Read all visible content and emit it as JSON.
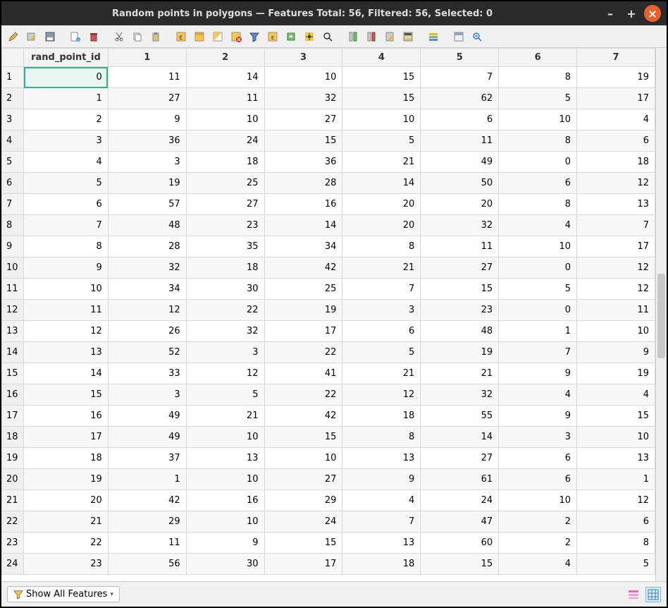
{
  "titlebar": {
    "title": "Random points in polygons — Features Total: 56, Filtered: 56, Selected: 0",
    "minimize": "–",
    "maximize": "+",
    "close": "×"
  },
  "toolbar_icons": [
    "pencil-icon",
    "multi-edit-icon",
    "save-icon",
    "sep",
    "new-feature-icon",
    "delete-icon",
    "sep",
    "cut-icon",
    "copy-icon",
    "paste-icon",
    "sep",
    "expression-new-icon",
    "select-all-icon",
    "invert-select-icon",
    "deselect-icon",
    "filter-icon",
    "select-expression-icon",
    "move-top-icon",
    "pan-to-icon",
    "zoom-to-icon",
    "sep",
    "new-column-icon",
    "delete-column-icon",
    "rename-column-icon",
    "open-calc-icon",
    "sep",
    "conditional-format-icon",
    "sep",
    "dock-icon",
    "actions-icon"
  ],
  "table": {
    "columns": [
      "rand_point_id",
      "1",
      "2",
      "3",
      "4",
      "5",
      "6",
      "7"
    ],
    "rows": [
      {
        "n": "1",
        "cells": [
          "0",
          "11",
          "14",
          "10",
          "15",
          "7",
          "8",
          "19"
        ],
        "selected": 0
      },
      {
        "n": "2",
        "cells": [
          "1",
          "27",
          "11",
          "32",
          "15",
          "62",
          "5",
          "17"
        ]
      },
      {
        "n": "3",
        "cells": [
          "2",
          "9",
          "10",
          "27",
          "10",
          "6",
          "10",
          "4"
        ]
      },
      {
        "n": "4",
        "cells": [
          "3",
          "36",
          "24",
          "15",
          "5",
          "11",
          "8",
          "6"
        ]
      },
      {
        "n": "5",
        "cells": [
          "4",
          "3",
          "18",
          "36",
          "21",
          "49",
          "0",
          "18"
        ]
      },
      {
        "n": "6",
        "cells": [
          "5",
          "19",
          "25",
          "28",
          "14",
          "50",
          "6",
          "12"
        ]
      },
      {
        "n": "7",
        "cells": [
          "6",
          "57",
          "27",
          "16",
          "20",
          "20",
          "8",
          "13"
        ]
      },
      {
        "n": "8",
        "cells": [
          "7",
          "48",
          "23",
          "14",
          "20",
          "32",
          "4",
          "7"
        ]
      },
      {
        "n": "9",
        "cells": [
          "8",
          "28",
          "35",
          "34",
          "8",
          "11",
          "10",
          "17"
        ]
      },
      {
        "n": "10",
        "cells": [
          "9",
          "32",
          "18",
          "42",
          "21",
          "27",
          "0",
          "12"
        ]
      },
      {
        "n": "11",
        "cells": [
          "10",
          "34",
          "30",
          "25",
          "7",
          "15",
          "5",
          "12"
        ]
      },
      {
        "n": "12",
        "cells": [
          "11",
          "12",
          "22",
          "19",
          "3",
          "23",
          "0",
          "11"
        ]
      },
      {
        "n": "13",
        "cells": [
          "12",
          "26",
          "32",
          "17",
          "6",
          "48",
          "1",
          "10"
        ]
      },
      {
        "n": "14",
        "cells": [
          "13",
          "52",
          "3",
          "22",
          "5",
          "19",
          "7",
          "9"
        ]
      },
      {
        "n": "15",
        "cells": [
          "14",
          "33",
          "12",
          "41",
          "21",
          "21",
          "9",
          "19"
        ]
      },
      {
        "n": "16",
        "cells": [
          "15",
          "3",
          "5",
          "22",
          "12",
          "32",
          "4",
          "4"
        ]
      },
      {
        "n": "17",
        "cells": [
          "16",
          "49",
          "21",
          "42",
          "18",
          "55",
          "9",
          "15"
        ]
      },
      {
        "n": "18",
        "cells": [
          "17",
          "49",
          "10",
          "15",
          "8",
          "14",
          "3",
          "10"
        ]
      },
      {
        "n": "19",
        "cells": [
          "18",
          "37",
          "13",
          "10",
          "13",
          "27",
          "6",
          "13"
        ]
      },
      {
        "n": "20",
        "cells": [
          "19",
          "1",
          "10",
          "27",
          "9",
          "61",
          "6",
          "1"
        ]
      },
      {
        "n": "21",
        "cells": [
          "20",
          "42",
          "16",
          "29",
          "4",
          "24",
          "10",
          "12"
        ]
      },
      {
        "n": "22",
        "cells": [
          "21",
          "29",
          "10",
          "24",
          "7",
          "47",
          "2",
          "6"
        ]
      },
      {
        "n": "23",
        "cells": [
          "22",
          "11",
          "9",
          "15",
          "13",
          "60",
          "2",
          "8"
        ]
      },
      {
        "n": "24",
        "cells": [
          "23",
          "56",
          "30",
          "17",
          "18",
          "15",
          "4",
          "5"
        ]
      }
    ]
  },
  "statusbar": {
    "filter_label": "Show All Features",
    "filter_glyph": "▾"
  }
}
